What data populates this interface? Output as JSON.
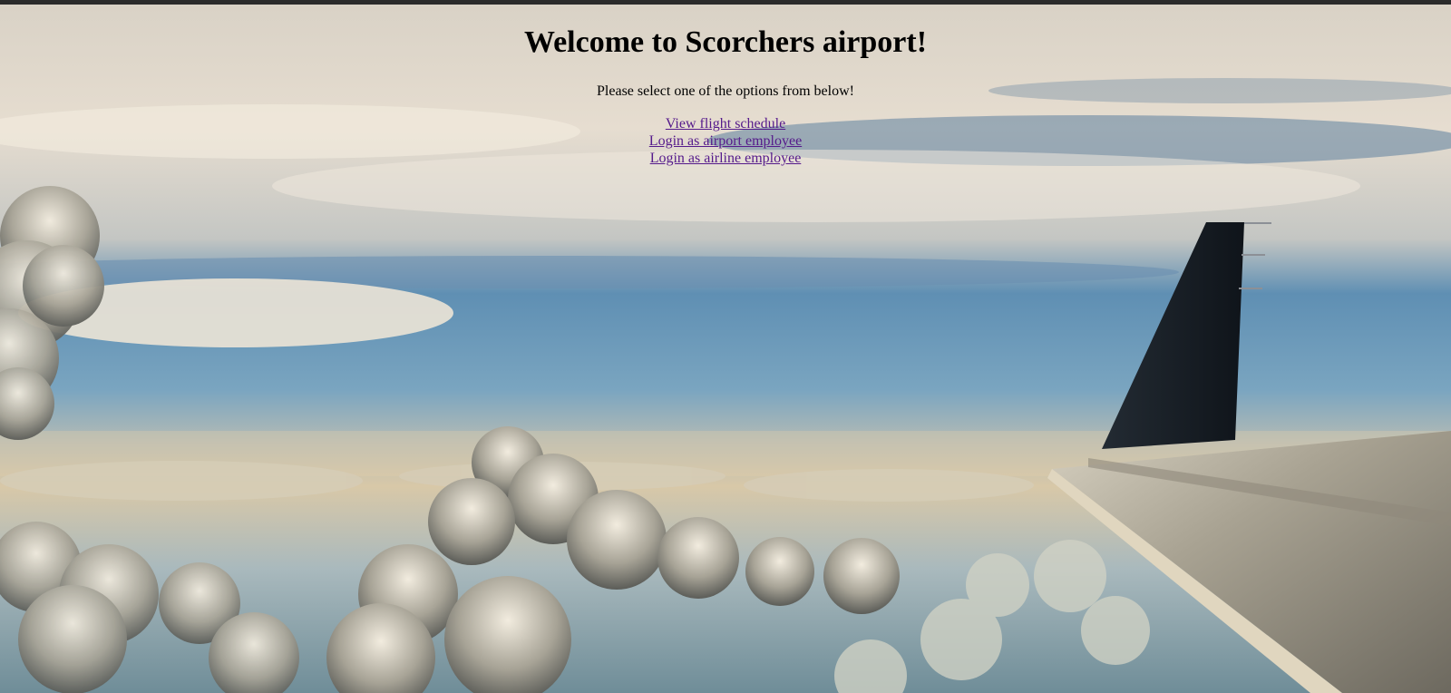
{
  "page": {
    "title": "Welcome to Scorchers airport!",
    "subtitle": "Please select one of the options from below!"
  },
  "links": [
    {
      "label": "View flight schedule"
    },
    {
      "label": "Login as airport employee"
    },
    {
      "label": "Login as airline employee"
    }
  ],
  "colors": {
    "link_visited": "#551a8b",
    "text": "#000000",
    "top_bar": "#2b2b2b"
  }
}
